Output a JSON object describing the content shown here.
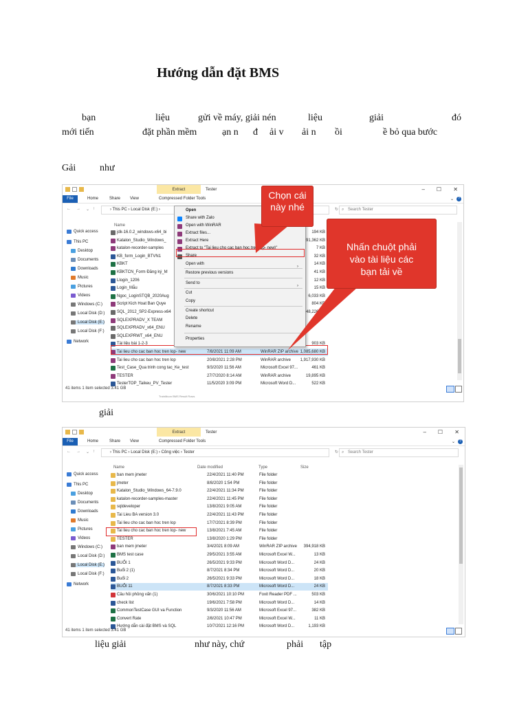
{
  "doc": {
    "title": "Hướng dẫn       đặt BMS",
    "para1_line1": [
      "bạn",
      "liệu",
      "gửi về máy, giải nén",
      "liệu",
      "giải",
      "đó"
    ],
    "para1_line2": [
      "mới tiến",
      "đặt phần mềm",
      "ạn n",
      "đ",
      "ải v",
      "ải n",
      "ồi",
      "ề bỏ qua bước"
    ],
    "line3": [
      "Gải",
      "như"
    ],
    "line4": "giải",
    "line5": [
      "liệu giải",
      "như này, chứ",
      "phải",
      "tập"
    ]
  },
  "colors": {
    "callout_red": "#e0362b",
    "highlight_red": "#e02a2a",
    "extract_tab": "#fbe7a4",
    "file_tab": "#1a5fb4",
    "selected_row": "#cce4f7",
    "folder_yellow": "#e8b84a"
  },
  "window1": {
    "extract_tab": "Extract",
    "tools_tab": "Compressed Folder Tools",
    "title": "Tester",
    "ribbon": [
      "File",
      "Home",
      "Share",
      "View"
    ],
    "breadcrumb": "›  This PC  ›  Local Disk (E:)  ›",
    "search_placeholder": "Search Tester",
    "col_name": "Name",
    "sidebar": [
      "Quick access",
      "This PC",
      "Desktop",
      "Documents",
      "Downloads",
      "Music",
      "Pictures",
      "Videos",
      "Windows (C:)",
      "Local Disk (D:)",
      "Local Disk (E:)",
      "Local Disk (F:)",
      "Network"
    ],
    "files": [
      {
        "name": "jdk-16.0.2_windows-x64_bi",
        "size": "194 KB",
        "icon": "exe-icon"
      },
      {
        "name": "Katalon_Studio_Windows_",
        "size": "491,362 KB",
        "icon": "archive-icon"
      },
      {
        "name": "katalon-recorder-samples",
        "size": "7 KB",
        "icon": "archive-icon"
      },
      {
        "name": "KB_form_Login_BTVN1",
        "size": "32 KB",
        "icon": "word-icon"
      },
      {
        "name": "KBKT",
        "size": "14 KB",
        "icon": "excel-icon"
      },
      {
        "name": "KBKTCN_Form Đăng ký_M",
        "size": "41 KB",
        "icon": "excel-icon"
      },
      {
        "name": "Llogin_1206",
        "size": "12 KB",
        "icon": "word-icon"
      },
      {
        "name": "Login_Mẫu",
        "size": "15 KB",
        "icon": "word-icon"
      },
      {
        "name": "Ngoc_LoginSTQB_2020Aug",
        "size": "6,033 KB",
        "icon": "excel-icon"
      },
      {
        "name": "Script Kich Hoat Ban Quye",
        "size": "804 KB",
        "icon": "archive-icon"
      },
      {
        "name": "SQL_2012_SP2-Express-x64",
        "size": "948,226 KB",
        "icon": "exe-icon"
      },
      {
        "name": "SQLEXPRADV_X TEAM",
        "size": "",
        "icon": "archive-icon"
      },
      {
        "name": "SQLEXPRADV_x64_ENU",
        "size": "",
        "icon": "exe-icon"
      },
      {
        "name": "SQLEXPRWT_x64_ENU",
        "size": "",
        "icon": "exe-icon"
      },
      {
        "name": "Tài liệu bài 1-2-3",
        "size": "903 KB",
        "icon": "word-icon"
      },
      {
        "name": "Tai lieu cho cac ban hoc tren lop- new",
        "date": "7/8/2021 11:09 AM",
        "type": "WinRAR ZIP archive",
        "size": "1,085,680 KB",
        "icon": "archive-icon"
      },
      {
        "name": "Tai lieu cho cac ban hoc tren lop",
        "date": "20/8/2021 2:28 PM",
        "type": "WinRAR archive",
        "size": "1,917,930 KB",
        "icon": "archive-icon"
      },
      {
        "name": "Test_Case_Qua trinh cong tac_Ke_test",
        "date": "9/3/2020 11:56 AM",
        "type": "Microsoft Excel 97...",
        "size": "461 KB",
        "icon": "excel-icon"
      },
      {
        "name": "TESTER",
        "date": "27/7/2020 8:14 AM",
        "type": "WinRAR archive",
        "size": "19,895 KB",
        "icon": "archive-icon"
      },
      {
        "name": "TesterTOP_Taikeu_PV_Tester",
        "date": "11/5/2020 3:09 PM",
        "type": "Microsoft Word D...",
        "size": "522 KB",
        "icon": "word-icon"
      }
    ],
    "status": "41 items    1 item selected  3.41 GB",
    "footer_ghost": "TrainMuon BMS Result Rows"
  },
  "context_menu": {
    "items": [
      "Open",
      "Share with Zalo",
      "Open with WinRAR",
      "Extract files...",
      "Extract Here",
      "Extract to \"Tai lieu cho cac ban hoc tren lop- new\\\"",
      "Share",
      "Open with",
      "Restore previous versions",
      "Send to",
      "Cut",
      "Copy",
      "Create shortcut",
      "Delete",
      "Rename",
      "Properties"
    ]
  },
  "callouts": {
    "choose": "Chọn cái này nhé",
    "rightclick": "Nhấn chuột phải vào tài liệu các bạn tải về"
  },
  "window2": {
    "extract_tab": "Extract",
    "tools_tab": "Compressed Folder Tools",
    "title": "Tester",
    "ribbon": [
      "File",
      "Home",
      "Share",
      "View"
    ],
    "breadcrumb": "›  This PC  ›  Local Disk (E:)  ›  Công việc  ›  Tester",
    "search_placeholder": "Search Tester",
    "columns": [
      "Name",
      "Date modified",
      "Type",
      "Size"
    ],
    "sidebar": [
      "Quick access",
      "This PC",
      "Desktop",
      "Documents",
      "Downloads",
      "Music",
      "Pictures",
      "Videos",
      "Windows (C:)",
      "Local Disk (D:)",
      "Local Disk (E:)",
      "Local Disk (F:)",
      "Network"
    ],
    "files": [
      {
        "name": "ban mem jmeter",
        "date": "22/4/2021 11:40 PM",
        "type": "File folder",
        "size": "",
        "icon": "folder-icon"
      },
      {
        "name": "jmeter",
        "date": "8/8/2020 1:54 PM",
        "type": "File folder",
        "size": "",
        "icon": "folder-icon"
      },
      {
        "name": "Katalon_Studio_Windows_64-7.9.0",
        "date": "22/4/2021 11:34 PM",
        "type": "File folder",
        "size": "",
        "icon": "folder-icon"
      },
      {
        "name": "katalon-recorder-samples-master",
        "date": "22/4/2021 11:45 PM",
        "type": "File folder",
        "size": "",
        "icon": "folder-icon"
      },
      {
        "name": "sqldeveloper",
        "date": "13/8/2021 9:05 AM",
        "type": "File folder",
        "size": "",
        "icon": "folder-icon"
      },
      {
        "name": "Tai Lieu BA version 3.0",
        "date": "22/4/2021 11:43 PM",
        "type": "File folder",
        "size": "",
        "icon": "folder-icon"
      },
      {
        "name": "Tai lieu cho cac ban hoc tren lop",
        "date": "17/7/2021 8:39 PM",
        "type": "File folder",
        "size": "",
        "icon": "folder-icon"
      },
      {
        "name": "Tai lieu cho cac ban hoc tren lop- new",
        "date": "13/8/2021 7:45 AM",
        "type": "File folder",
        "size": "",
        "icon": "folder-icon"
      },
      {
        "name": "TESTER",
        "date": "13/8/2020 1:29 PM",
        "type": "File folder",
        "size": "",
        "icon": "folder-icon"
      },
      {
        "name": "ban mem jmeter",
        "date": "3/4/2021 8:09 AM",
        "type": "WinRAR ZIP archive",
        "size": "394,918 KB",
        "icon": "archive-icon"
      },
      {
        "name": "BMS test case",
        "date": "29/5/2021 3:55 AM",
        "type": "Microsoft Excel W...",
        "size": "13 KB",
        "icon": "excel-icon"
      },
      {
        "name": "BUỔI 1",
        "date": "26/5/2021 9:33 PM",
        "type": "Microsoft Word D...",
        "size": "24 KB",
        "icon": "word-icon"
      },
      {
        "name": "Buổi 2 (1)",
        "date": "8/7/2021 8:34 PM",
        "type": "Microsoft Word D...",
        "size": "20 KB",
        "icon": "word-icon"
      },
      {
        "name": "Buổi 2",
        "date": "26/5/2021 9:33 PM",
        "type": "Microsoft Word D...",
        "size": "18 KB",
        "icon": "word-icon"
      },
      {
        "name": "BUỔI 11",
        "date": "8/7/2021 8:33 PM",
        "type": "Microsoft Word D...",
        "size": "24 KB",
        "icon": "word-icon"
      },
      {
        "name": "Câu hỏi phỏng vấn (1)",
        "date": "30/6/2021 10:10 PM",
        "type": "Foxit Reader PDF ...",
        "size": "503 KB",
        "icon": "pdf-icon"
      },
      {
        "name": "check list",
        "date": "19/6/2021 7:58 PM",
        "type": "Microsoft Word D...",
        "size": "14 KB",
        "icon": "word-icon"
      },
      {
        "name": "CommonTestCase GUI va Function",
        "date": "9/3/2020 11:56 AM",
        "type": "Microsoft Excel 97...",
        "size": "382 KB",
        "icon": "excel-icon"
      },
      {
        "name": "Convert Rate",
        "date": "2/8/2021 10:47 PM",
        "type": "Microsoft Excel W...",
        "size": "11 KB",
        "icon": "excel-icon"
      },
      {
        "name": "Hướng dẫn cài đặt BMS và SQL",
        "date": "10/7/2021 12:16 PM",
        "type": "Microsoft Word D...",
        "size": "1,193 KB",
        "icon": "word-icon"
      }
    ],
    "status": "41 items    1 item selected  3.41 GB"
  }
}
